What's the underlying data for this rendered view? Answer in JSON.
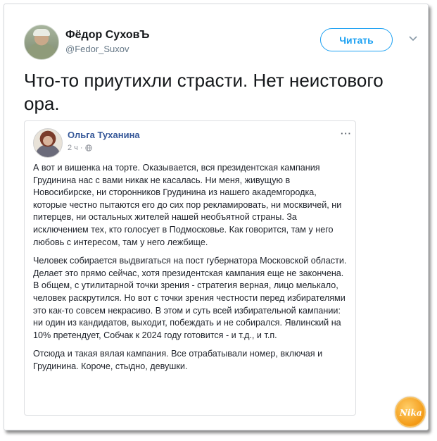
{
  "tweet": {
    "display_name": "Фёдор СуховЪ",
    "handle": "@Fedor_Suxov",
    "follow_label": "Читать",
    "text": "Что-то приутихли страсти. Нет неистового ора."
  },
  "embedded_post": {
    "author": "Ольга Туханина",
    "time": "2 ч",
    "separator": "·",
    "more_label": "···",
    "paragraphs": [
      "А вот и вишенка на торте. Оказывается, вся президентская кампания Грудинина нас с вами никак не касалась. Ни меня, живущую в Новосибирске, ни сторонников Грудинина из нашего академгородка, которые честно пытаются его до сих пор рекламировать, ни москвичей, ни питерцев, ни остальных жителей нашей необъятной страны. За исключением тех, кто голосует в Подмосковье. Как говорится, там у него любовь с интересом, там у него лежбище.",
      "Человек собирается выдвигаться на пост губернатора Московской области. Делает это прямо сейчас, хотя президентская кампания еще не закончена. В общем, с утилитарной точки зрения - стратегия верная, лицо мелькало, человек раскрутился. Но вот с точки зрения честности перед избирателями это как-то совсем некрасиво. В этом и суть всей избирательной кампании: ни один из кандидатов, выходит, побеждать и не собирался. Явлинский на 10% претендует, Собчак к 2024 году готовится - и т.д., и т.п.",
      "Отсюда и такая вялая кампания. Все отрабатывали номер, включая и Грудинина. Короче, стыдно, девушки."
    ]
  },
  "colors": {
    "accent": "#1da1f2",
    "fb_name": "#365899",
    "text": "#14171a",
    "muted": "#657786"
  },
  "icons": {
    "chevron": "chevron-down-icon",
    "globe": "globe-icon",
    "watermark": "site-logo"
  },
  "watermark_text": "Nika"
}
